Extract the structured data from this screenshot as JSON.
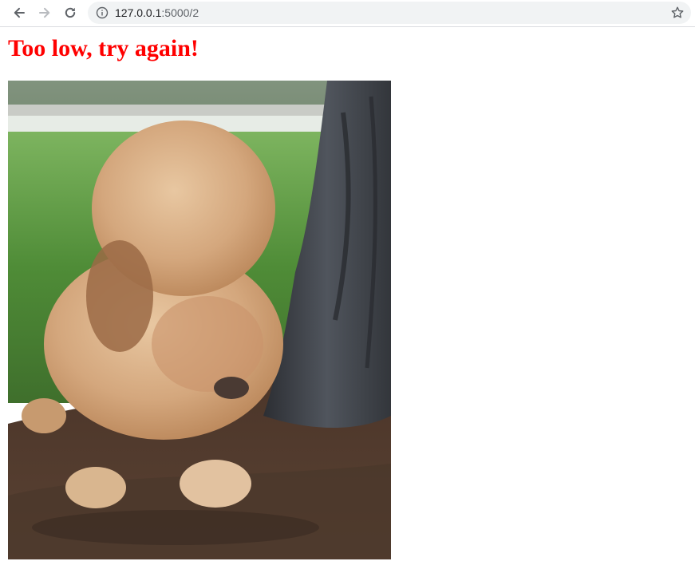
{
  "browser": {
    "url_host": "127.0.0.1",
    "url_path": ":5000/2",
    "icons": [
      "back-arrow-icon",
      "forward-arrow-icon",
      "reload-icon",
      "info-icon",
      "star-icon"
    ]
  },
  "page": {
    "message": "Too low, try again!",
    "message_color": "#ff0000",
    "image_subject": "puppy-digging-icon"
  }
}
